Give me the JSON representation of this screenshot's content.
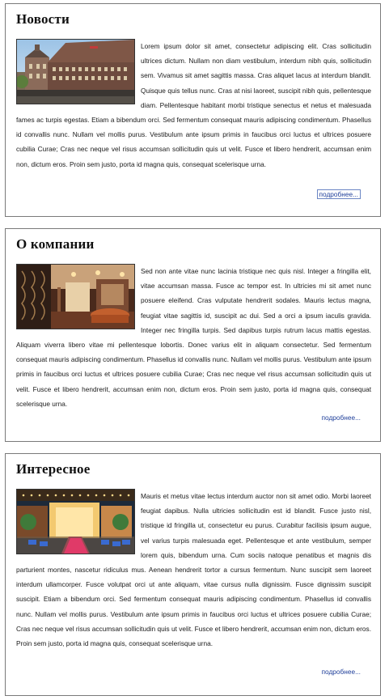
{
  "sections": [
    {
      "title": "Новости",
      "image": "city-street-buildings-photo",
      "text": "Lorem ipsum dolor sit amet, consectetur adipiscing elit. Cras sollicitudin ultrices dictum. Nullam non diam vestibulum, interdum nibh quis, sollicitudin sem. Vivamus sit amet sagittis massa. Cras aliquet lacus at interdum blandit. Quisque quis tellus nunc. Cras at nisi laoreet, suscipit nibh quis, pellentesque diam. Pellentesque habitant morbi tristique senectus et netus et malesuada fames ac turpis egestas. Etiam a bibendum orci. Sed fermentum consequat mauris adipiscing condimentum. Phasellus id convallis nunc. Nullam vel mollis purus. Vestibulum ante ipsum primis in faucibus orci luctus et ultrices posuere cubilia Curae; Cras nec neque vel risus accumsan sollicitudin quis ut velit. Fusce et libero hendrerit, accumsan enim non, dictum eros. Proin sem justo, porta id magna quis, consequat scelerisque urna.",
      "more": "подробнее..."
    },
    {
      "title": "О компании",
      "image": "hotel-interior-lounge-photo",
      "text": "Sed non ante vitae nunc lacinia tristique nec quis nisl. Integer a fringilla elit, vitae accumsan massa. Fusce ac tempor est. In ultricies mi sit amet nunc posuere eleifend. Cras vulputate hendrerit sodales. Mauris lectus magna, feugiat vitae sagittis id, suscipit ac dui. Sed a orci a ipsum iaculis gravida. Integer nec fringilla turpis. Sed dapibus turpis rutrum lacus mattis egestas. Aliquam viverra libero vitae mi pellentesque lobortis. Donec varius elit in aliquam consectetur. Sed fermentum consequat mauris adipiscing condimentum. Phasellus id convallis nunc. Nullam vel mollis purus. Vestibulum ante ipsum primis in faucibus orci luctus et ultrices posuere cubilia Curae; Cras nec neque vel risus accumsan sollicitudin quis ut velit. Fusce et libero hendrerit, accumsan enim non, dictum eros. Proin sem justo, porta id magna quis, consequat scelerisque urna.",
      "more": "подробнее..."
    },
    {
      "title": "Интересное",
      "image": "hotel-entrance-night-photo",
      "text": "Mauris et metus vitae lectus interdum auctor non sit amet odio. Morbi laoreet feugiat dapibus. Nulla ultricies sollicitudin est id blandit. Fusce justo nisl, tristique id fringilla ut, consectetur eu purus. Curabitur facilisis ipsum augue, vel varius turpis malesuada eget. Pellentesque et ante vestibulum, semper lorem quis, bibendum urna. Cum sociis natoque penatibus et magnis dis parturient montes, nascetur ridiculus mus. Aenean hendrerit tortor a cursus fermentum. Nunc suscipit sem laoreet interdum ullamcorper. Fusce volutpat orci ut ante aliquam, vitae cursus nulla dignissim. Fusce dignissim suscipit suscipit. Etiam a bibendum orci. Sed fermentum consequat mauris adipiscing condimentum. Phasellus id convallis nunc. Nullam vel mollis purus. Vestibulum ante ipsum primis in faucibus orci luctus et ultrices posuere cubilia Curae; Cras nec neque vel risus accumsan sollicitudin quis ut velit. Fusce et libero hendrerit, accumsan enim non, dictum eros. Proin sem justo, porta id magna quis, consequat scelerisque urna.",
      "more": "подробнее..."
    }
  ],
  "colors": {
    "link": "#1f3f9a",
    "border": "#7a7a7a",
    "text": "#1a1a1a"
  }
}
